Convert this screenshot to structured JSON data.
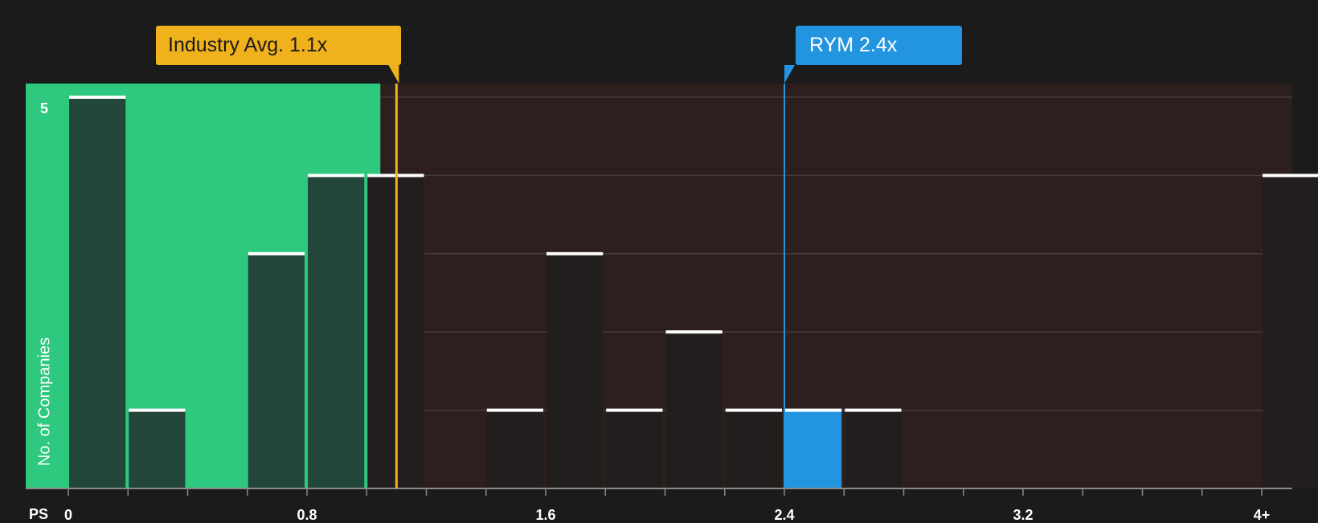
{
  "chart_data": {
    "type": "bar",
    "xlabel": "PS",
    "ylabel": "No. of Companies",
    "y_max_tick_label": "5",
    "ylim": [
      0,
      5
    ],
    "xlim": [
      0,
      4
    ],
    "x_ticks": [
      "0",
      "0.8",
      "1.6",
      "2.4",
      "3.2",
      "4+"
    ],
    "bin_width": 0.2,
    "bins": [
      {
        "x_start": 0.0,
        "count": 5
      },
      {
        "x_start": 0.2,
        "count": 1
      },
      {
        "x_start": 0.6,
        "count": 3
      },
      {
        "x_start": 0.8,
        "count": 4
      },
      {
        "x_start": 1.0,
        "count": 4
      },
      {
        "x_start": 1.4,
        "count": 1
      },
      {
        "x_start": 1.6,
        "count": 3
      },
      {
        "x_start": 1.8,
        "count": 1
      },
      {
        "x_start": 2.0,
        "count": 2
      },
      {
        "x_start": 2.2,
        "count": 1
      },
      {
        "x_start": 2.4,
        "count": 1,
        "highlight": true
      },
      {
        "x_start": 2.6,
        "count": 1
      },
      {
        "x_start": 4.0,
        "count": 4
      }
    ],
    "industry_avg": {
      "label": "Industry Avg. 1.1x",
      "value": 1.1
    },
    "company": {
      "label": "RYM 2.4x",
      "value": 2.4
    },
    "colors": {
      "background": "#1b1b1b",
      "undervalued_zone": "#2ec87f",
      "overvalued_zone": "#2e1f1f",
      "avg_marker": "#f0b21c",
      "company_marker": "#2394e0",
      "bar_in_green_zone": "#22463a",
      "bar_in_red_zone": "#231e1e",
      "bar_top": "#ffffff",
      "gridline": "#4a3b3b"
    }
  }
}
